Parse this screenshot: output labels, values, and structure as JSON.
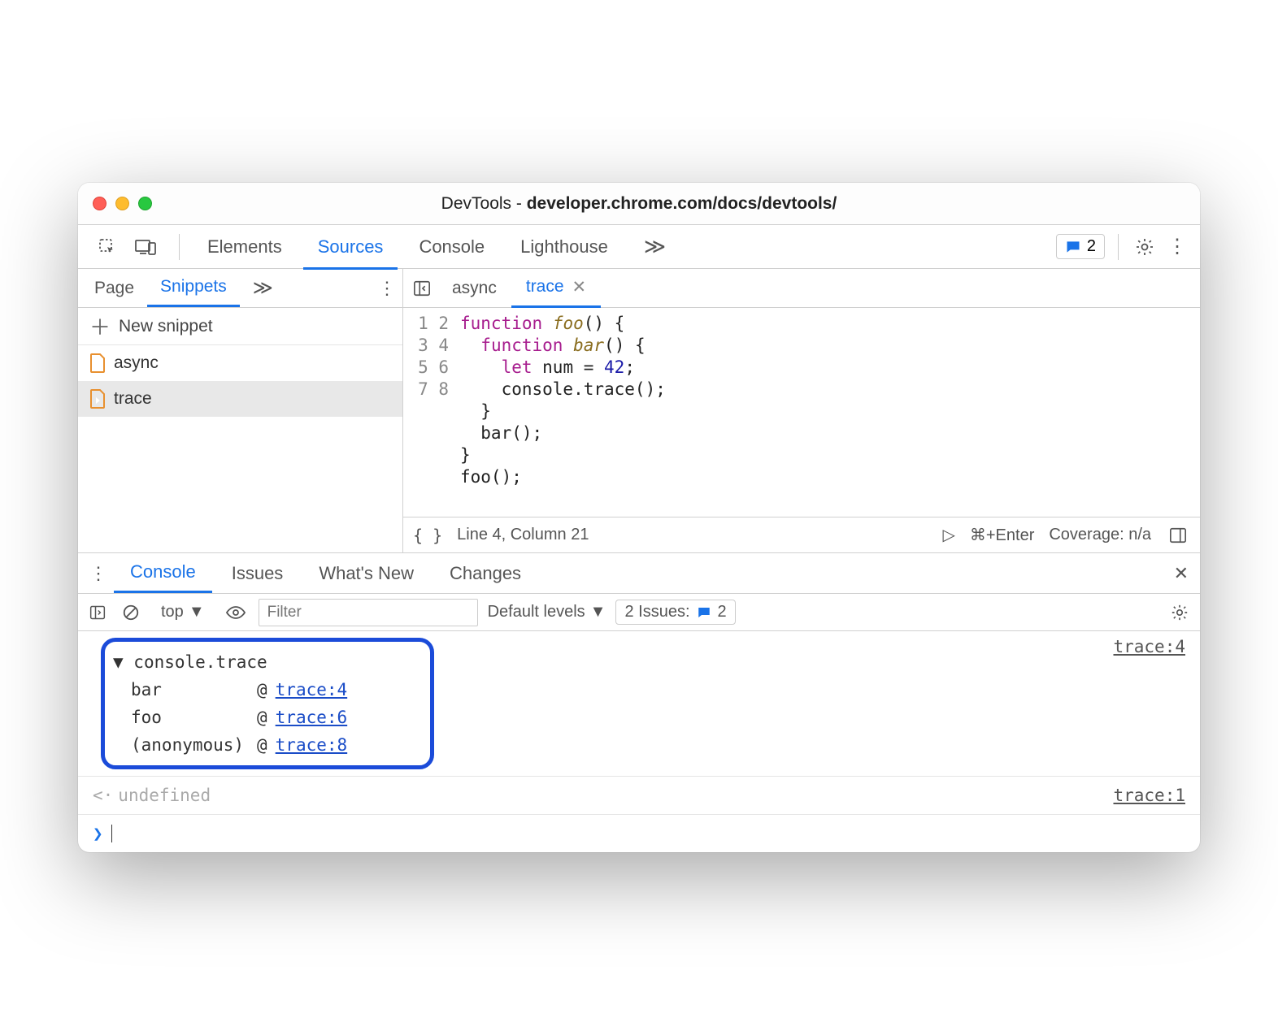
{
  "window": {
    "title_prefix": "DevTools - ",
    "title_bold": "developer.chrome.com/docs/devtools/"
  },
  "tabs": {
    "elements": "Elements",
    "sources": "Sources",
    "console": "Console",
    "lighthouse": "Lighthouse",
    "overflow": "≫"
  },
  "header": {
    "issue_count": "2"
  },
  "navigator": {
    "tabs": {
      "page": "Page",
      "snippets": "Snippets",
      "overflow": "≫"
    },
    "new_snippet": "New snippet",
    "items": [
      "async",
      "trace"
    ],
    "selected": 1
  },
  "editor": {
    "tabs": [
      "async",
      "trace"
    ],
    "active": 1,
    "code": [
      {
        "n": "1",
        "html": "<span class='kw'>function</span> <span class='fn'>foo</span>() {"
      },
      {
        "n": "2",
        "html": "  <span class='kw'>function</span> <span class='fn'>bar</span>() {"
      },
      {
        "n": "3",
        "html": "    <span class='kw'>let</span> num = <span class='num'>42</span>;"
      },
      {
        "n": "4",
        "html": "    console.trace();"
      },
      {
        "n": "5",
        "html": "  }"
      },
      {
        "n": "6",
        "html": "  bar();"
      },
      {
        "n": "7",
        "html": "}"
      },
      {
        "n": "8",
        "html": "foo();"
      }
    ],
    "status": {
      "pretty": "{ }",
      "pos": "Line 4, Column 21",
      "run": "▷",
      "shortcut": "⌘+Enter",
      "coverage": "Coverage: n/a"
    }
  },
  "drawer": {
    "tabs": {
      "console": "Console",
      "issues": "Issues",
      "whatsnew": "What's New",
      "changes": "Changes"
    }
  },
  "console_toolbar": {
    "context": "top",
    "filter_placeholder": "Filter",
    "levels": "Default levels",
    "issues_label": "2 Issues:",
    "issues_count": "2"
  },
  "console_output": {
    "trace_header": "console.trace",
    "trace_src": "trace:4",
    "stack": [
      {
        "fn": "bar",
        "loc": "trace:4"
      },
      {
        "fn": "foo",
        "loc": "trace:6"
      },
      {
        "fn": "(anonymous)",
        "loc": "trace:8"
      }
    ],
    "return": {
      "arrow": "<·",
      "value": "undefined",
      "src": "trace:1"
    }
  }
}
